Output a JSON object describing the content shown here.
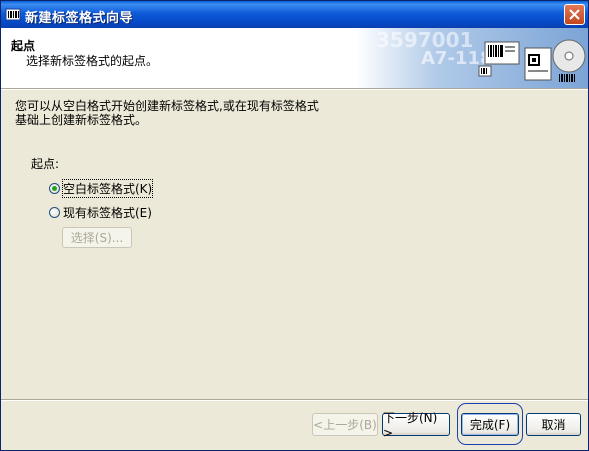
{
  "window": {
    "title": "新建标签格式向导"
  },
  "header": {
    "heading": "起点",
    "subheading": "选择新标签格式的起点。",
    "art_text_1": "3597001",
    "art_text_2": "A7-118"
  },
  "main": {
    "intro": "您可以从空白格式开始创建新标签格式,或在现有标签格式基础上创建新标签格式。",
    "intro_line1": "您可以从空白格式开始创建新标签格式,或在现有标签格式",
    "intro_line2": "基础上创建新标签格式。",
    "origin_label": "起点:",
    "options": [
      {
        "label": "空白标签格式(K)",
        "selected": true
      },
      {
        "label": "现有标签格式(E)",
        "selected": false
      }
    ],
    "select_button": "选择(S)..."
  },
  "footer": {
    "back": "<上一步(B)",
    "next": "下一步(N) >",
    "finish": "完成(F)",
    "cancel": "取消"
  },
  "colors": {
    "title_bar": "#0A5FD8",
    "close": "#C4461C",
    "dialog_bg": "#ECE9D8"
  }
}
